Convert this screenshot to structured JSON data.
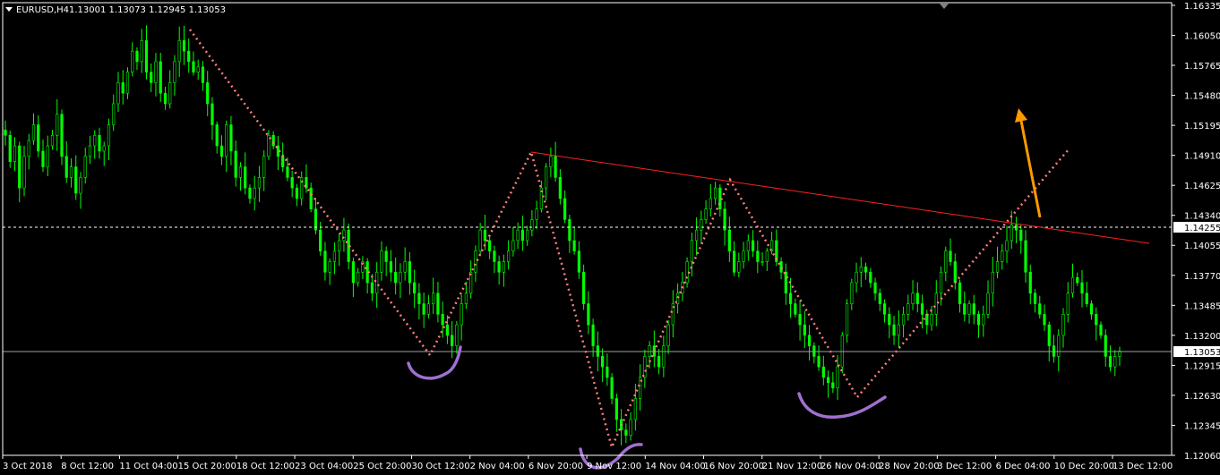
{
  "window": {
    "symbol": "EURUSD,H4",
    "ohlc": "1.13001 1.13073 1.12945 1.13053"
  },
  "colors": {
    "background": "#000000",
    "frame": "#ffffff",
    "candle": "#00ff00",
    "pattern_line": "#ff7f7f",
    "neckline": "#ff2020",
    "arrow": "#ff9900",
    "shoulder_marker": "#a070d0",
    "bid_line": "#a0a0a0",
    "alert_line": "#ffffff"
  },
  "chart_data": {
    "type": "candlestick",
    "title": "EURUSD,H4  1.13001 1.13073 1.12945 1.13053",
    "ylim": [
      1.1206,
      1.1636
    ],
    "yticks": [
      "1.16335",
      "1.16050",
      "1.15765",
      "1.15480",
      "1.15195",
      "1.14910",
      "1.14625",
      "1.14340",
      "1.14055",
      "1.13770",
      "1.13485",
      "1.13200",
      "1.12915",
      "1.12630",
      "1.12345",
      "1.12060"
    ],
    "xticks": [
      "3 Oct 2018",
      "8 Oct 12:00",
      "11 Oct 04:00",
      "15 Oct 20:00",
      "18 Oct 12:00",
      "23 Oct 04:00",
      "25 Oct 20:00",
      "30 Oct 12:00",
      "2 Nov 04:00",
      "6 Nov 20:00",
      "9 Nov 12:00",
      "14 Nov 04:00",
      "16 Nov 20:00",
      "21 Nov 12:00",
      "26 Nov 04:00",
      "28 Nov 20:00",
      "3 Dec 12:00",
      "6 Dec 04:00",
      "10 Dec 20:00",
      "13 Dec 12:00"
    ],
    "price_labels": {
      "alert": "1.14255",
      "bid": "1.13053"
    },
    "price_levels": {
      "alert": 1.14255,
      "bid": 1.13053
    },
    "closes": [
      1.151,
      1.1485,
      1.15,
      1.146,
      1.149,
      1.1505,
      1.152,
      1.1495,
      1.148,
      1.15,
      1.151,
      1.153,
      1.149,
      1.147,
      1.148,
      1.1455,
      1.147,
      1.149,
      1.15,
      1.151,
      1.1495,
      1.15,
      1.152,
      1.154,
      1.156,
      1.155,
      1.157,
      1.159,
      1.158,
      1.16,
      1.157,
      1.156,
      1.158,
      1.155,
      1.154,
      1.156,
      1.158,
      1.16,
      1.159,
      1.158,
      1.157,
      1.1575,
      1.156,
      1.154,
      1.152,
      1.15,
      1.149,
      1.152,
      1.1495,
      1.147,
      1.148,
      1.146,
      1.145,
      1.146,
      1.147,
      1.149,
      1.151,
      1.15,
      1.149,
      1.148,
      1.147,
      1.146,
      1.145,
      1.147,
      1.146,
      1.144,
      1.142,
      1.14,
      1.138,
      1.139,
      1.14,
      1.141,
      1.142,
      1.139,
      1.137,
      1.138,
      1.139,
      1.137,
      1.136,
      1.138,
      1.14,
      1.139,
      1.138,
      1.137,
      1.138,
      1.139,
      1.137,
      1.136,
      1.135,
      1.134,
      1.135,
      1.136,
      1.134,
      1.133,
      1.132,
      1.131,
      1.133,
      1.135,
      1.136,
      1.138,
      1.14,
      1.142,
      1.141,
      1.14,
      1.139,
      1.138,
      1.139,
      1.14,
      1.141,
      1.142,
      1.141,
      1.142,
      1.143,
      1.144,
      1.146,
      1.148,
      1.149,
      1.147,
      1.145,
      1.143,
      1.141,
      1.14,
      1.138,
      1.135,
      1.133,
      1.131,
      1.13,
      1.129,
      1.128,
      1.126,
      1.124,
      1.123,
      1.1225,
      1.124,
      1.126,
      1.128,
      1.13,
      1.131,
      1.13,
      1.129,
      1.131,
      1.133,
      1.135,
      1.136,
      1.137,
      1.139,
      1.141,
      1.142,
      1.143,
      1.144,
      1.145,
      1.146,
      1.144,
      1.142,
      1.14,
      1.138,
      1.139,
      1.14,
      1.141,
      1.14,
      1.139,
      1.139,
      1.14,
      1.141,
      1.139,
      1.138,
      1.136,
      1.135,
      1.134,
      1.133,
      1.132,
      1.131,
      1.13,
      1.129,
      1.128,
      1.1275,
      1.127,
      1.129,
      1.132,
      1.135,
      1.137,
      1.138,
      1.1385,
      1.138,
      1.137,
      1.136,
      1.135,
      1.134,
      1.133,
      1.132,
      1.133,
      1.134,
      1.135,
      1.136,
      1.135,
      1.134,
      1.133,
      1.134,
      1.136,
      1.138,
      1.14,
      1.139,
      1.137,
      1.135,
      1.134,
      1.135,
      1.134,
      1.133,
      1.134,
      1.136,
      1.138,
      1.139,
      1.14,
      1.141,
      1.1425,
      1.142,
      1.141,
      1.138,
      1.136,
      1.135,
      1.134,
      1.133,
      1.131,
      1.13,
      1.132,
      1.134,
      1.136,
      1.1375,
      1.137,
      1.136,
      1.135,
      1.134,
      1.133,
      1.132,
      1.13,
      1.129,
      1.13,
      1.1305
    ]
  }
}
